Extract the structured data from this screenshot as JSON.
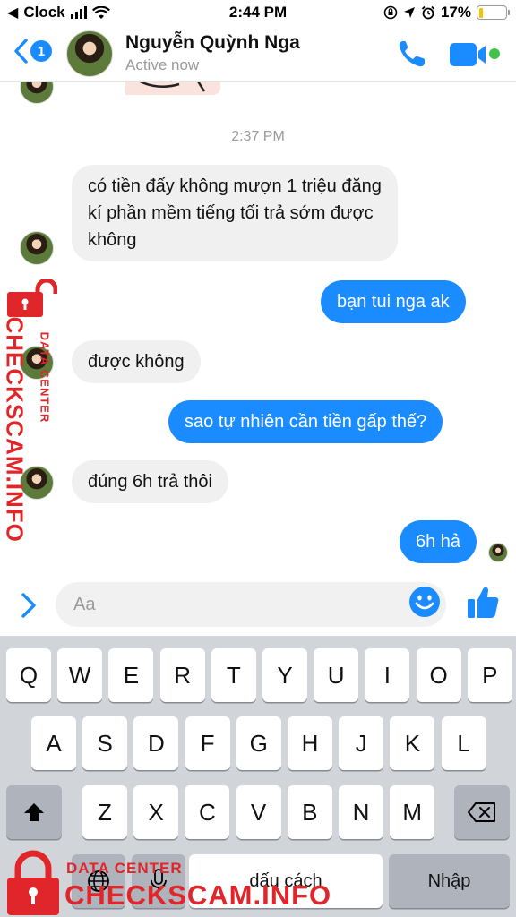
{
  "status_bar": {
    "carrier": "Clock",
    "time": "2:44 PM",
    "battery_percent": "17%",
    "battery_level": 0.17
  },
  "header": {
    "back_badge": "1",
    "contact_name": "Nguyễn Quỳnh Nga",
    "status": "Active now",
    "back_icon": "chevron-left-icon",
    "call_icon": "phone-icon",
    "video_icon": "video-camera-icon",
    "accent_color": "#1a8cff",
    "online_color": "#44c04d"
  },
  "conversation": {
    "timestamp": "2:37 PM",
    "messages": [
      {
        "direction": "incoming",
        "text": "có tiền đấy không mượn 1 triệu đăng kí phần mềm tiếng tối trả sớm được không"
      },
      {
        "direction": "outgoing",
        "text": "bạn tui nga ak"
      },
      {
        "direction": "incoming",
        "text": "được không"
      },
      {
        "direction": "outgoing",
        "text": "sao tự nhiên cần tiền gấp thế?"
      },
      {
        "direction": "incoming",
        "text": "đúng 6h trả thôi"
      },
      {
        "direction": "outgoing",
        "text": "6h hả"
      }
    ]
  },
  "composer": {
    "placeholder": "Aa",
    "expand_icon": "chevron-right-icon",
    "emoji_icon": "smiley-icon",
    "like_icon": "thumbs-up-icon"
  },
  "keyboard": {
    "row1": [
      "Q",
      "W",
      "E",
      "R",
      "T",
      "Y",
      "U",
      "I",
      "O",
      "P"
    ],
    "row2": [
      "A",
      "S",
      "D",
      "F",
      "G",
      "H",
      "J",
      "K",
      "L"
    ],
    "row3": [
      "Z",
      "X",
      "C",
      "V",
      "B",
      "N",
      "M"
    ],
    "space_label": "dấu cách",
    "return_label": "Nhập",
    "shift_icon": "shift-icon",
    "delete_icon": "backspace-icon",
    "globe_icon": "globe-icon",
    "mic_icon": "microphone-icon"
  },
  "watermark": {
    "small_text": "DATA CENTER",
    "big_text": "CHECKSCAM.INFO",
    "color": "#e0262a"
  }
}
